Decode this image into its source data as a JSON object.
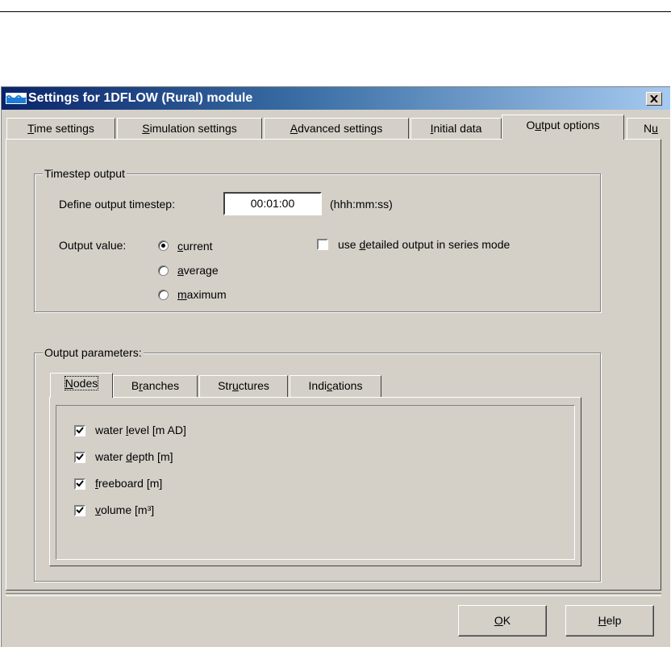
{
  "window": {
    "title": "Settings for 1DFLOW (Rural) module",
    "close_label": "x"
  },
  "tabs": [
    {
      "pre": "",
      "u": "T",
      "post": "ime settings"
    },
    {
      "pre": "",
      "u": "S",
      "post": "imulation settings"
    },
    {
      "pre": "",
      "u": "A",
      "post": "dvanced settings"
    },
    {
      "pre": "",
      "u": "I",
      "post": "nitial data"
    },
    {
      "pre": "O",
      "u": "u",
      "post": "tput options"
    },
    {
      "pre": "N",
      "u": "u",
      "post": ""
    }
  ],
  "active_tab": "Output options",
  "timestep": {
    "group_label": "Timestep output",
    "define_label": "Define output timestep:",
    "value": "00:01:00",
    "format_hint": "(hhh:mm:ss)",
    "output_value_label": "Output value:",
    "options": [
      {
        "pre": "",
        "u": "c",
        "post": "urrent",
        "selected": true
      },
      {
        "pre": "",
        "u": "a",
        "post": "verage",
        "selected": false
      },
      {
        "pre": "",
        "u": "m",
        "post": "aximum",
        "selected": false
      }
    ],
    "detailed": {
      "pre": "use ",
      "u": "d",
      "post": "etailed output in series mode",
      "checked": false
    }
  },
  "parameters": {
    "group_label": "Output parameters:",
    "subtabs": [
      {
        "pre": "",
        "u": "N",
        "post": "odes"
      },
      {
        "pre": "B",
        "u": "r",
        "post": "anches"
      },
      {
        "pre": "Str",
        "u": "u",
        "post": "ctures"
      },
      {
        "pre": "Indi",
        "u": "c",
        "post": "ations"
      }
    ],
    "items": [
      {
        "pre": "water ",
        "u": "l",
        "post": "evel [m AD]",
        "checked": true
      },
      {
        "pre": "water ",
        "u": "d",
        "post": "epth [m]",
        "checked": true
      },
      {
        "pre": "",
        "u": "f",
        "post": "reeboard [m]",
        "checked": true
      },
      {
        "pre": "",
        "u": "v",
        "post": "olume [m³]",
        "checked": true
      }
    ]
  },
  "buttons": {
    "ok": {
      "pre": "",
      "u": "O",
      "post": "K"
    },
    "help": {
      "pre": "",
      "u": "H",
      "post": "elp"
    }
  }
}
